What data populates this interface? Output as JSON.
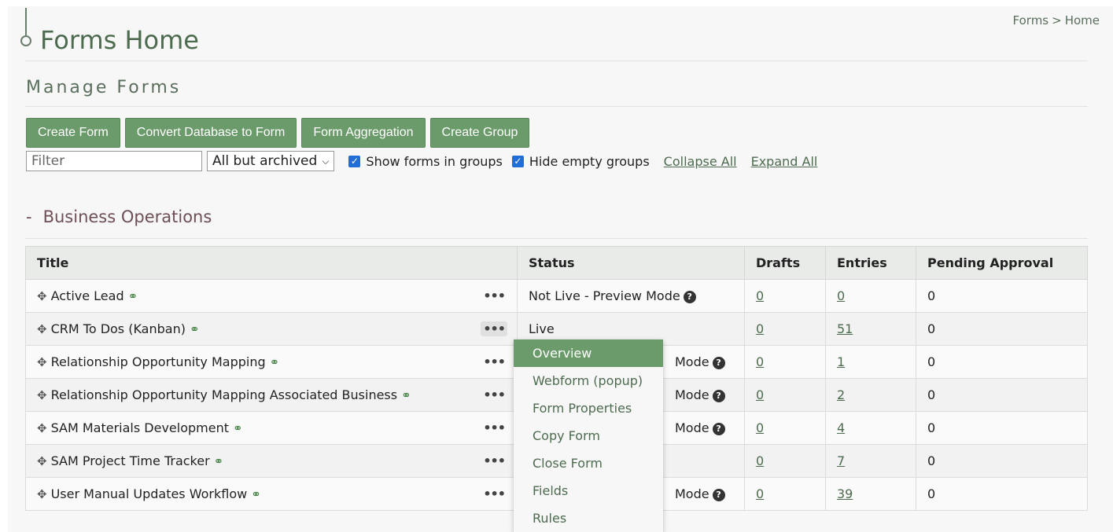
{
  "header": {
    "title": "Forms Home"
  },
  "breadcrumb": {
    "parent": "Forms",
    "separator": ">",
    "current": "Home"
  },
  "section": {
    "title": "Manage Forms"
  },
  "toolbar": {
    "create_form": "Create Form",
    "convert_db": "Convert Database to Form",
    "aggregation": "Form Aggregation",
    "create_group": "Create Group"
  },
  "filter": {
    "placeholder": "Filter",
    "value": "",
    "select_value": "All but archived",
    "show_groups_label": "Show forms in groups",
    "hide_empty_label": "Hide empty groups",
    "collapse_all": "Collapse All",
    "expand_all": "Expand All"
  },
  "group": {
    "toggle": "-",
    "name": "Business Operations"
  },
  "table": {
    "headers": {
      "title": "Title",
      "status": "Status",
      "drafts": "Drafts",
      "entries": "Entries",
      "pending": "Pending Approval"
    },
    "rows": [
      {
        "title": "Active Lead",
        "status": "Not Live - Preview Mode",
        "drafts": "0",
        "entries": "0",
        "pending": "0"
      },
      {
        "title": "CRM To Dos (Kanban)",
        "status": "Live",
        "drafts": "0",
        "entries": "51",
        "pending": "0"
      },
      {
        "title": "Relationship Opportunity Mapping",
        "status": "Mode",
        "drafts": "0",
        "entries": "1",
        "pending": "0"
      },
      {
        "title": "Relationship Opportunity Mapping Associated Business",
        "status": "Mode",
        "drafts": "0",
        "entries": "2",
        "pending": "0"
      },
      {
        "title": "SAM Materials Development",
        "status": "Mode",
        "drafts": "0",
        "entries": "4",
        "pending": "0"
      },
      {
        "title": "SAM Project Time Tracker",
        "status": "",
        "drafts": "0",
        "entries": "7",
        "pending": "0"
      },
      {
        "title": "User Manual Updates Workflow",
        "status": "Mode",
        "drafts": "0",
        "entries": "39",
        "pending": "0"
      }
    ]
  },
  "context_menu": {
    "items": [
      "Overview",
      "Webform (popup)",
      "Form Properties",
      "Copy Form",
      "Close Form",
      "Fields",
      "Rules"
    ]
  },
  "icons": {
    "move": "✥",
    "link": "⚭",
    "dots": "•••",
    "help": "?",
    "chevron": "⌵",
    "check": "✓"
  },
  "colors": {
    "accent": "#6b9a6b",
    "title": "#4d6b4f",
    "group": "#6e4f56"
  }
}
